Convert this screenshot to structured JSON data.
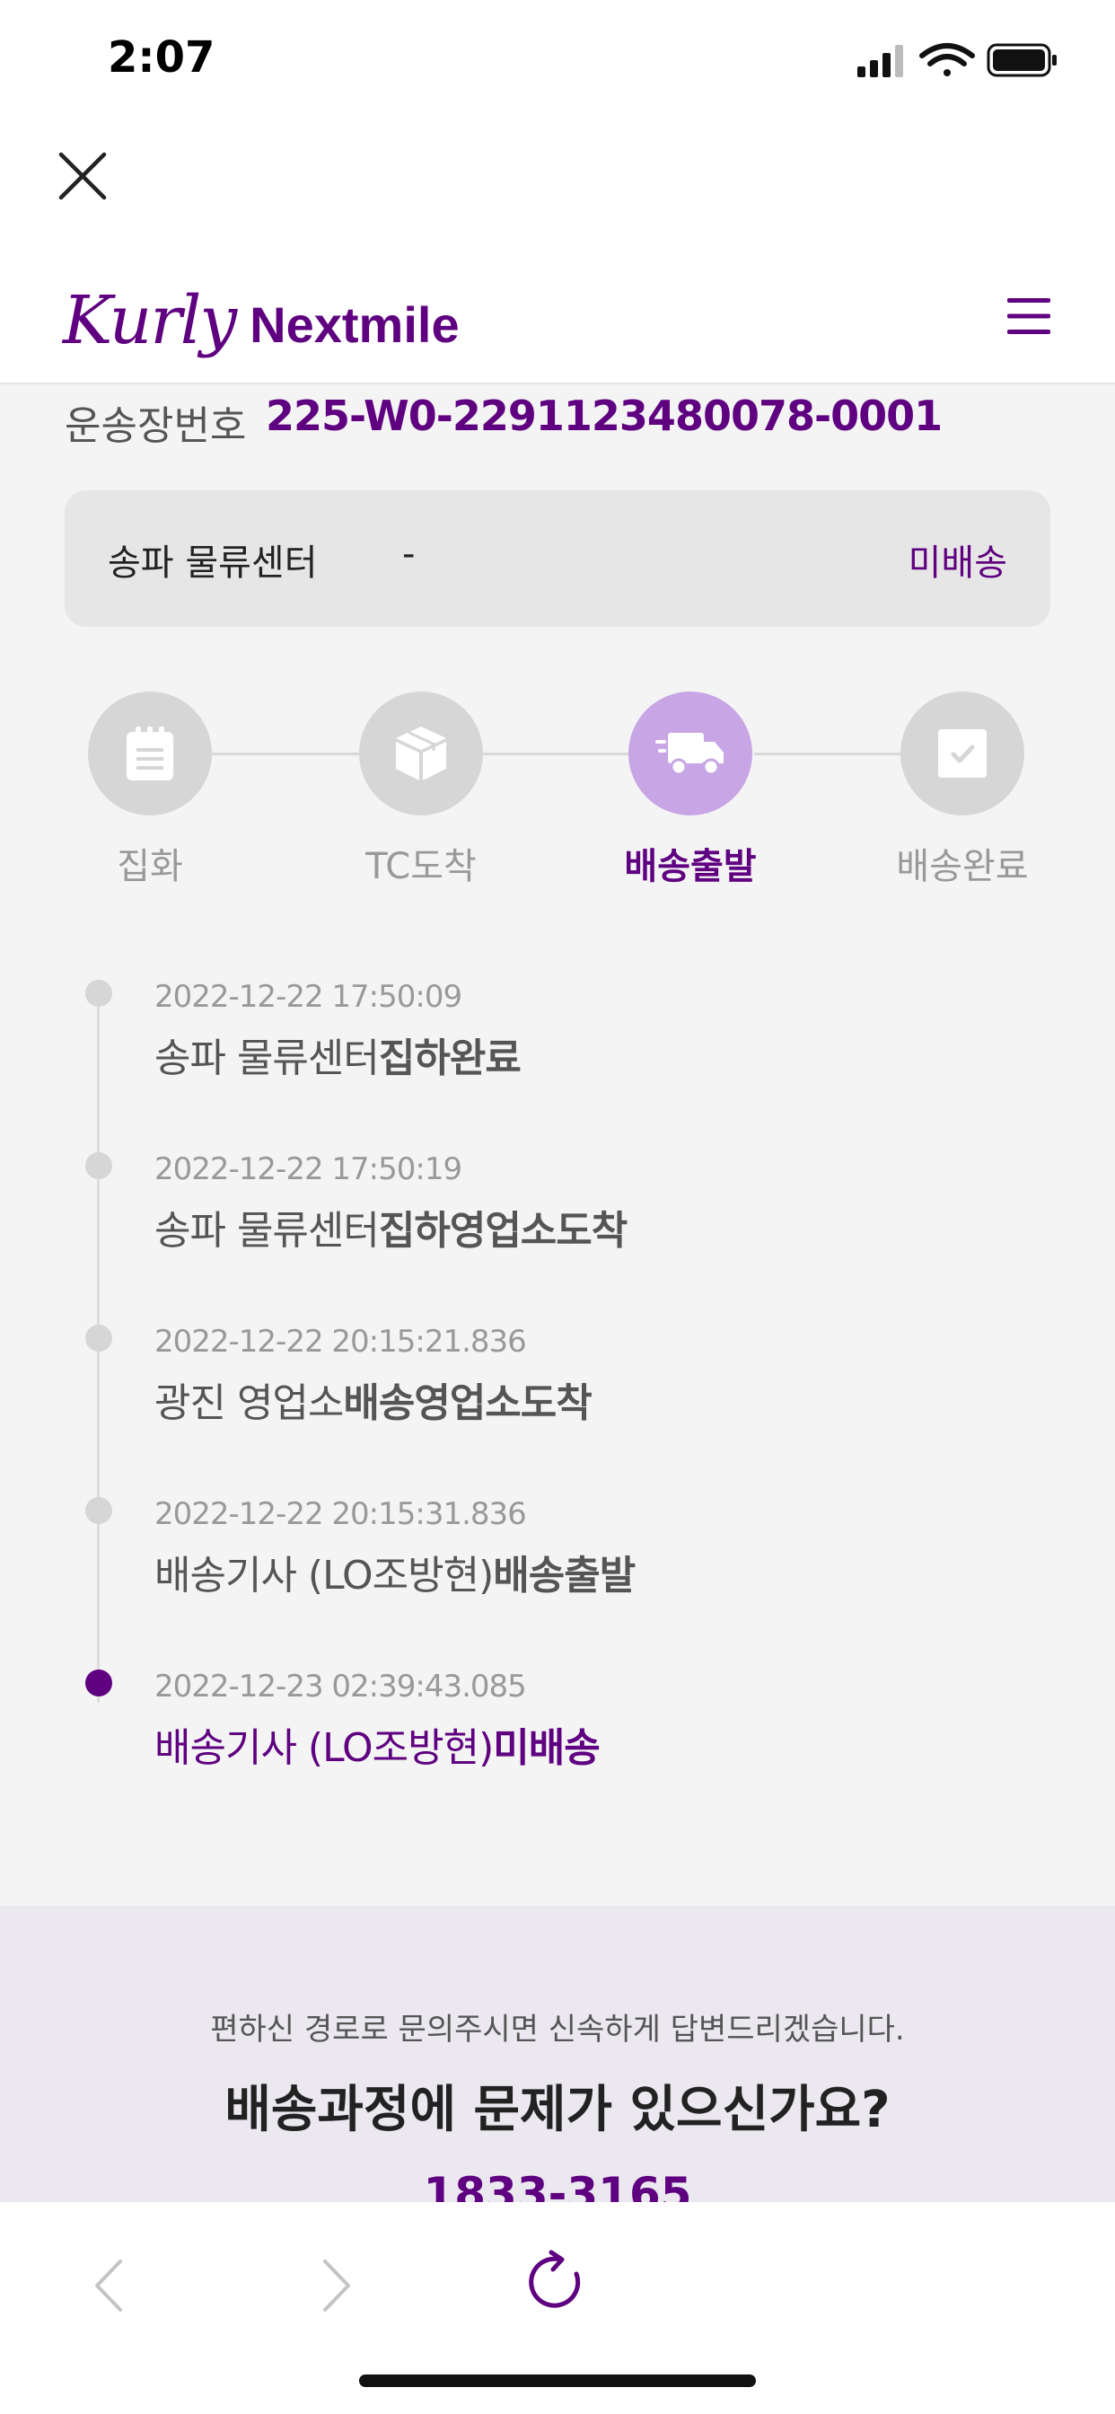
{
  "status_bar": {
    "time": "2:07"
  },
  "header": {
    "logo_script": "Kurly",
    "logo_text": "Nextmile"
  },
  "waybill": {
    "label": "운송장번호",
    "number": "225-W0-2291123480078-0001"
  },
  "center": {
    "name": "송파 물류센터",
    "dash": "-",
    "status": "미배송"
  },
  "steps": [
    {
      "label": "집화",
      "icon": "clipboard-icon",
      "active": false
    },
    {
      "label": "TC도착",
      "icon": "box-icon",
      "active": false
    },
    {
      "label": "배송출발",
      "icon": "truck-icon",
      "active": true
    },
    {
      "label": "배송완료",
      "icon": "check-icon",
      "active": false
    }
  ],
  "timeline": [
    {
      "date": "2022-12-22 17:50:09",
      "place": "송파 물류센터",
      "event": "집하완료"
    },
    {
      "date": "2022-12-22 17:50:19",
      "place": "송파 물류센터",
      "event": "집하영업소도착"
    },
    {
      "date": "2022-12-22 20:15:21.836",
      "place": "광진 영업소",
      "event": "배송영업소도착"
    },
    {
      "date": "2022-12-22 20:15:31.836",
      "place": "배송기사 (LO조방현)",
      "event": "배송출발"
    },
    {
      "date": "2022-12-23 02:39:43.085",
      "place": "배송기사 (LO조방현)",
      "event": "미배송"
    }
  ],
  "inquiry": {
    "subtitle": "편하신 경로로 문의주시면 신속하게 답변드리겠습니다.",
    "title": "배송과정에 문제가 있으신가요?",
    "phone": "1833-3165"
  },
  "colors": {
    "brand": "#5f0080",
    "active_step": "#c8a6e6"
  }
}
